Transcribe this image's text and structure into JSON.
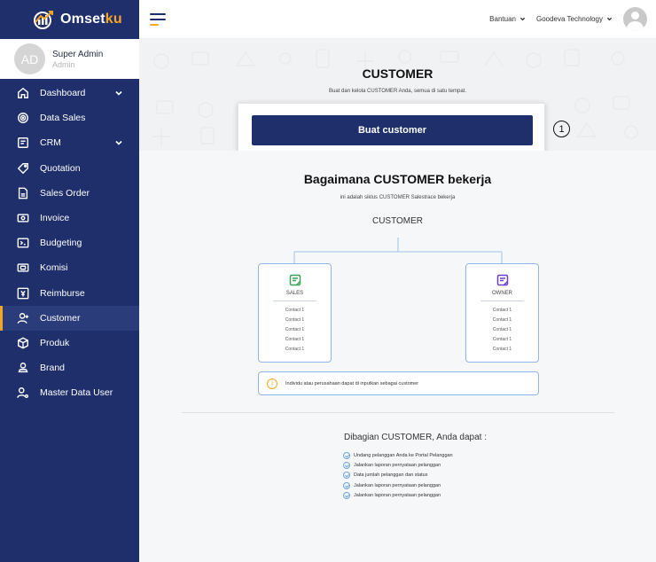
{
  "brand": {
    "name_main": "Omset",
    "name_accent": "ku"
  },
  "profile": {
    "initials": "AD",
    "name": "Super Admin",
    "role": "Admin"
  },
  "sidebar": {
    "items": [
      {
        "label": "Dashboard",
        "icon": "home-icon",
        "has_chevron": true
      },
      {
        "label": "Data Sales",
        "icon": "target-icon",
        "has_chevron": false
      },
      {
        "label": "CRM",
        "icon": "crm-icon",
        "has_chevron": true
      },
      {
        "label": "Quotation",
        "icon": "tag-icon",
        "has_chevron": false
      },
      {
        "label": "Sales Order",
        "icon": "document-icon",
        "has_chevron": false
      },
      {
        "label": "Invoice",
        "icon": "invoice-icon",
        "has_chevron": false
      },
      {
        "label": "Budgeting",
        "icon": "budget-icon",
        "has_chevron": false
      },
      {
        "label": "Komisi",
        "icon": "money-icon",
        "has_chevron": false
      },
      {
        "label": "Reimburse",
        "icon": "reimburse-icon",
        "has_chevron": false
      },
      {
        "label": "Customer",
        "icon": "user-add-icon",
        "has_chevron": false,
        "active": true
      },
      {
        "label": "Produk",
        "icon": "box-icon",
        "has_chevron": false
      },
      {
        "label": "Brand",
        "icon": "brand-icon",
        "has_chevron": false
      },
      {
        "label": "Master Data User",
        "icon": "user-gear-icon",
        "has_chevron": false
      }
    ]
  },
  "topbar": {
    "help_label": "Bantuan",
    "company_label": "Goodeva Technology"
  },
  "hero": {
    "title": "CUSTOMER",
    "subtitle": "Buat dan kelola CUSTOMER Anda, semua di satu tempat.",
    "cta_label": "Buat customer",
    "step_badge": "1"
  },
  "how": {
    "title": "Bagaimana CUSTOMER bekerja",
    "subtitle": "ini adalah siklus CUSTOMER Salestrace bekerja",
    "root_label": "CUSTOMER",
    "boxes": [
      {
        "label": "SALES",
        "icon": "sales-note-icon",
        "contacts": [
          "Contact 1",
          "Contact 1",
          "Contact 1",
          "Contact 1",
          "Contact 1"
        ]
      },
      {
        "label": "OWNER",
        "icon": "owner-note-icon",
        "contacts": [
          "Contact 1",
          "Contact 1",
          "Contact 1",
          "Contact 1",
          "Contact 1"
        ]
      }
    ],
    "info_text": "Individu atau perusahaan dapat di inputkan sebagai customer"
  },
  "capabilities": {
    "title": "Dibagian CUSTOMER, Anda dapat :",
    "items": [
      "Undang pelanggan Anda ke Portal Pelanggan",
      "Jalankan laporan pernyataan pelanggan",
      "Data jumlah pelanggan dan status",
      "Jalankan laporan pernyataan pelanggan",
      "Jalankan laporan pernyataan pelanggan"
    ]
  },
  "colors": {
    "sidebar_bg": "#1e2f6b",
    "accent": "#f5a524",
    "box_border": "#8fb6e6",
    "sales_icon": "#3aa35a",
    "owner_icon": "#6b3fd1"
  }
}
